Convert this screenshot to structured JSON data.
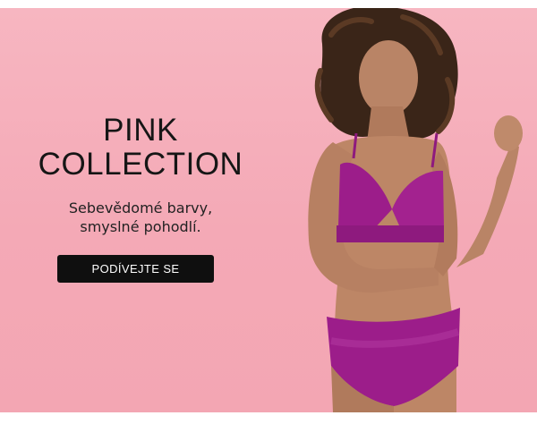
{
  "banner": {
    "title_line_1": "PINK",
    "title_line_2": "COLLECTION",
    "subtitle_line_1": "Sebevědomé barvy,",
    "subtitle_line_2": "smyslné pohodlí.",
    "cta_label": "PODÍVEJTE SE"
  },
  "colors": {
    "background": "#f5adb9",
    "cta_background": "#0f0f0f",
    "lingerie": "#9c1d8a"
  },
  "icons": {
    "hero_image": "model-in-magenta-lingerie"
  }
}
